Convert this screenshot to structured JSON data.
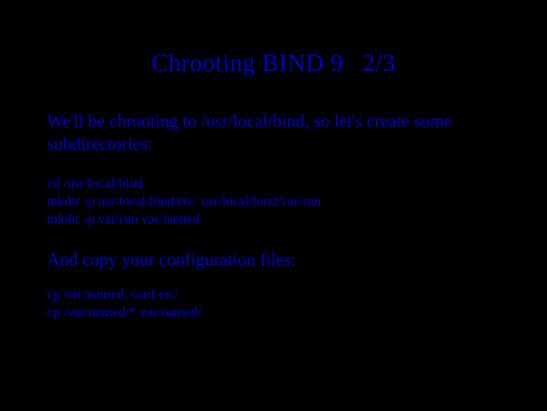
{
  "title_main": "Chrooting BIND 9",
  "title_page": "2/3",
  "intro_text": "We'll be chrooting to /usr/local/bind, so let's create some subdirectories:",
  "code1": {
    "line1": "cd /usr/local/bind",
    "line2": "mkdir -p usr/local/bind/etc/ usr/local/bind/var/run",
    "line3": "mkdir -p var/run var/named"
  },
  "mid_text": "And copy your configuration files:",
  "code2": {
    "line1": "cp /etc/named. conf etc/",
    "line2": "cp /var/named/* var/named/"
  }
}
